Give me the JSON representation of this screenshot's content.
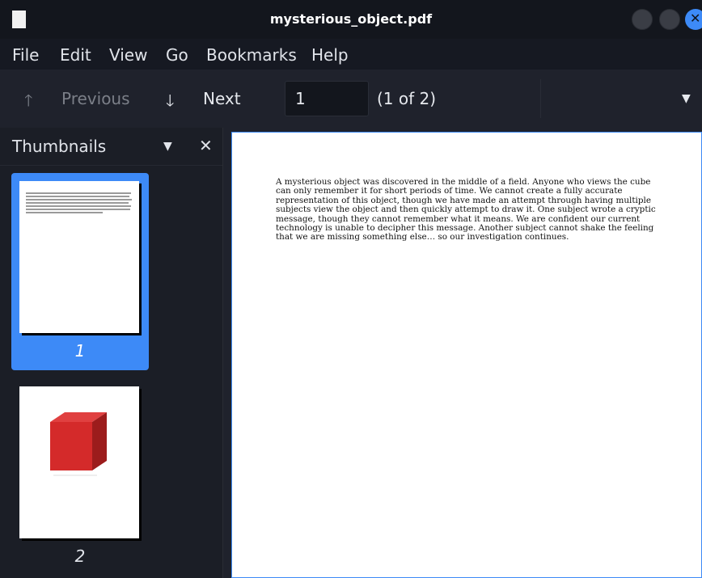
{
  "window": {
    "title": "mysterious_object.pdf"
  },
  "menu": {
    "items": [
      "File",
      "Edit",
      "View",
      "Go",
      "Bookmarks",
      "Help"
    ]
  },
  "toolbar": {
    "previous_label": "Previous",
    "next_label": "Next",
    "page_value": "1",
    "page_count": "(1 of 2)",
    "icons": {
      "previous": "arrow-up-icon",
      "next": "arrow-down-icon",
      "menu": "chevron-down-icon"
    }
  },
  "sidebar": {
    "title": "Thumbnails",
    "thumbnails": [
      {
        "label": "1",
        "selected": true
      },
      {
        "label": "2",
        "selected": false
      }
    ]
  },
  "document": {
    "page1_text": "A mysterious object was discovered in the middle of a field. Anyone who views the cube can only remember it for short periods of time. We cannot create a fully accurate representation of this object, though we have made an attempt through having multiple subjects view the object and then quickly attempt to draw it. One subject wrote a cryptic message, though they cannot remember what it means. We are confident our current technology is unable to decipher this message. Another subject cannot shake the feeling that we are missing something else… so our investigation continues."
  },
  "colors": {
    "accent": "#3d8af7",
    "cube_front": "#d42a2a",
    "cube_top": "#e04040",
    "cube_side": "#9c1c1c"
  }
}
